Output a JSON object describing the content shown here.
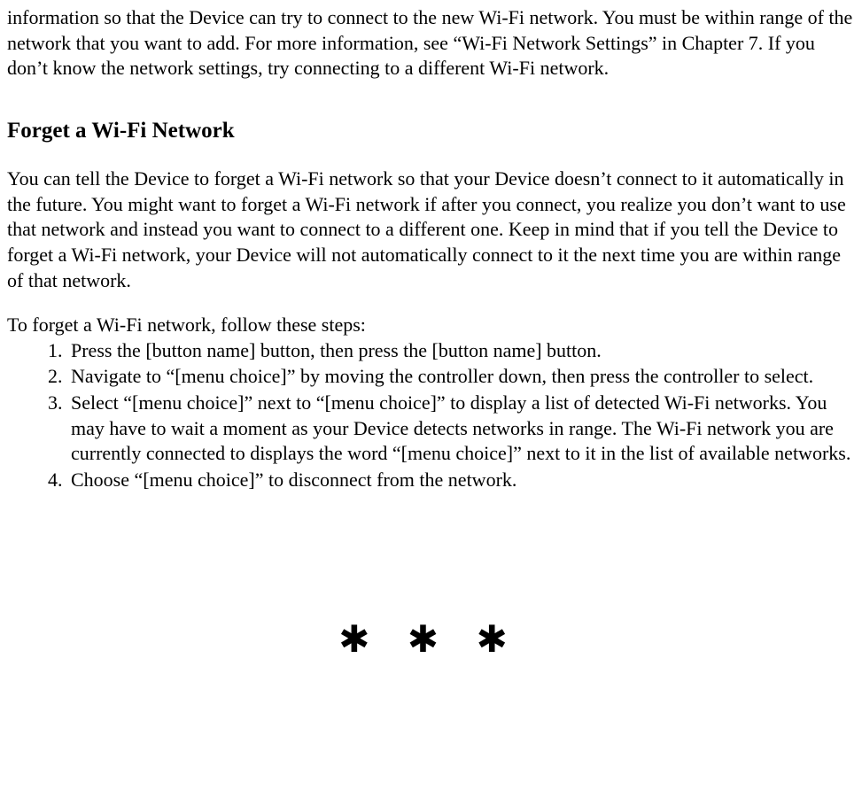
{
  "intro_paragraph": "information so that the Device can try to connect to the new Wi-Fi network. You must be within range of the network that you want to add. For more information, see “Wi-Fi Network Settings” in Chapter 7. If you don’t know the network settings, try connecting to a different Wi-Fi network.",
  "heading": "Forget a Wi-Fi Network",
  "forget_paragraph": "You can tell the Device to forget a Wi-Fi network so that your Device doesn’t connect to it automatically in the future. You might want to forget a Wi-Fi network if after you connect, you realize you don’t want to use that network and instead you want to connect to a different one. Keep in mind that if you tell the Device to forget a Wi-Fi network, your Device will not automatically connect to it the next time you are within range of that network.",
  "steps_intro": "To forget a Wi-Fi network, follow these steps:",
  "steps": [
    "Press the [button name] button, then press the [button name] button.",
    "Navigate to “[menu choice]” by moving the controller down, then press the controller to select.",
    "Select “[menu choice]” next to “[menu choice]” to display a list of detected Wi-Fi networks. You may have to wait a moment as your Device detects networks in range. The Wi-Fi network you are currently connected to displays the word “[menu choice]” next to it in the list of available networks.",
    "Choose “[menu choice]” to disconnect from the network."
  ],
  "divider": "✱  ✱  ✱"
}
